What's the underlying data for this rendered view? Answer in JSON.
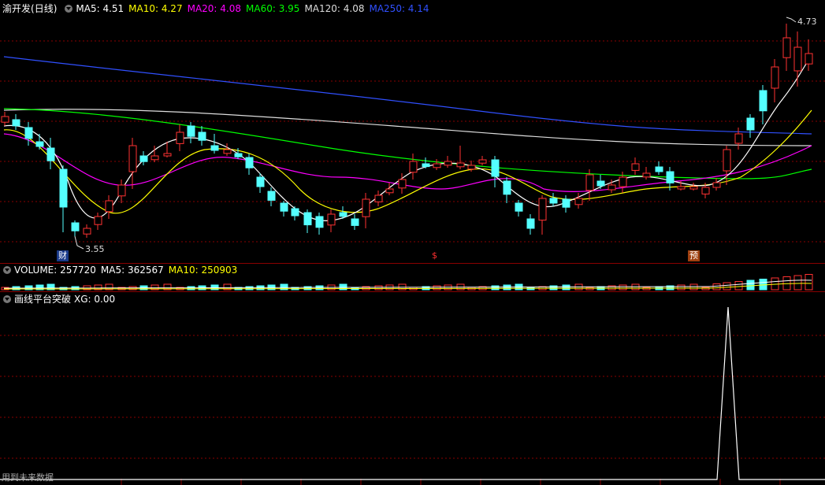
{
  "main_header": {
    "stock_name": "渝开发",
    "period": "(日线)",
    "ma": [
      {
        "label": "MA5: 4.51",
        "color": "#ffffff"
      },
      {
        "label": "MA10: 4.27",
        "color": "#ffff00"
      },
      {
        "label": "MA20: 4.08",
        "color": "#ff00ff"
      },
      {
        "label": "MA60: 3.95",
        "color": "#00ff00"
      },
      {
        "label": "MA120: 4.08",
        "color": "#dddddd"
      },
      {
        "label": "MA250: 4.14",
        "color": "#3050ff"
      }
    ]
  },
  "price_labels": {
    "high": "4.73",
    "low": "3.55"
  },
  "event_badges": [
    {
      "text": "财",
      "bg": "#1a3a8a",
      "fg": "#ffffff"
    },
    {
      "text": "$",
      "bg": "#000000",
      "fg": "#ff3030"
    },
    {
      "text": "预",
      "bg": "#a04010",
      "fg": "#ffffff"
    }
  ],
  "volume_header": {
    "volume": "VOLUME: 257720",
    "ma5": "MA5: 362567",
    "ma10": "MA10: 250903"
  },
  "indicator_header": {
    "name": "画线平台突破",
    "value": "XG: 0.00"
  },
  "footer": {
    "text": "用到未来数据"
  },
  "colors": {
    "up": "#ff3232",
    "down": "#54ffff",
    "grid": "#8a0000",
    "ma5": "#ffffff",
    "ma10": "#ffff00",
    "ma20": "#ff00ff",
    "ma60": "#00ff00",
    "ma120": "#dddddd",
    "ma250": "#3050ff"
  }
}
